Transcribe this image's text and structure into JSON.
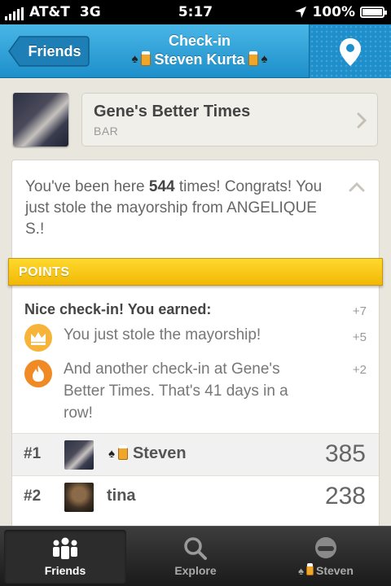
{
  "status_bar": {
    "carrier": "AT&T",
    "network": "3G",
    "time": "5:17",
    "battery": "100%"
  },
  "nav": {
    "back_label": "Friends",
    "title": "Check-in",
    "subtitle": "Steven Kurta",
    "map_icon": "location-pin-icon"
  },
  "venue": {
    "name": "Gene's Better Times",
    "category": "BAR"
  },
  "message": {
    "prefix": "You've been here ",
    "count": "544",
    "suffix": " times! Congrats! You just stole the mayorship from ANGELIQUE S.!"
  },
  "points": {
    "banner": "POINTS",
    "header": "Nice check-in! You earned:",
    "total": "+7",
    "reasons": [
      {
        "text": "You just stole the mayorship!",
        "points": "+5",
        "icon": "crown-icon",
        "color": "#f6b53a"
      },
      {
        "text": "And another check-in at Gene's Better Times. That's 41 days in a row!",
        "points": "+2",
        "icon": "flame-icon",
        "color": "#f08a24"
      }
    ]
  },
  "leaderboard": [
    {
      "rank": "#1",
      "name": "Steven",
      "score": "385"
    },
    {
      "rank": "#2",
      "name": "tina",
      "score": "238"
    }
  ],
  "tabs": [
    {
      "label": "Friends",
      "icon": "friends-icon"
    },
    {
      "label": "Explore",
      "icon": "search-icon"
    },
    {
      "label": "Steven",
      "icon": "profile-icon"
    }
  ],
  "colors": {
    "nav_blue": "#1d8fca",
    "points_yellow": "#f7c411",
    "tabbar": "#1f1f1f"
  }
}
